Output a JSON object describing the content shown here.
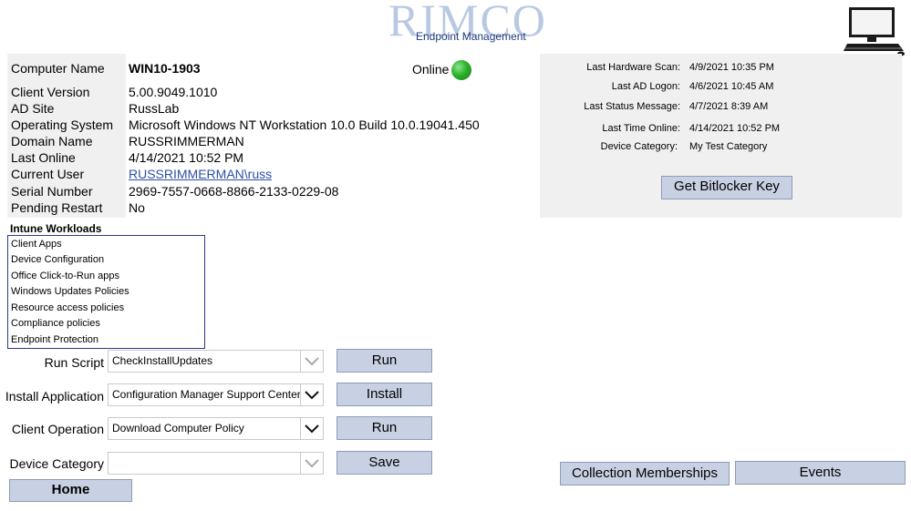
{
  "header": {
    "logo_word": "RIMCO",
    "logo_sub": "Endpoint Management"
  },
  "computer_info": {
    "rows": [
      {
        "label": "Computer Name",
        "value": "WIN10-1903"
      },
      {
        "label": "Client Version",
        "value": "5.00.9049.1010"
      },
      {
        "label": "AD Site",
        "value": "RussLab"
      },
      {
        "label": "Operating System",
        "value": "Microsoft Windows NT Workstation 10.0 Build 10.0.19041.450"
      },
      {
        "label": "Domain Name",
        "value": "RUSSRIMMERMAN"
      },
      {
        "label": "Last Online",
        "value": "4/14/2021 10:52 PM"
      },
      {
        "label": "Current User",
        "value": "RUSSRIMMERMAN\\russ"
      },
      {
        "label": "Serial Number",
        "value": "2969-7557-0668-8866-2133-0229-08"
      },
      {
        "label": "Pending Restart",
        "value": "No"
      }
    ],
    "status_text": "Online",
    "status_color": "#2bb32b"
  },
  "status_panel": {
    "rows": [
      {
        "label": "Last Hardware Scan:",
        "value": "4/9/2021 10:35 PM"
      },
      {
        "label": "Last AD Logon:",
        "value": "4/6/2021 10:45 AM"
      },
      {
        "label": "Last Status Message:",
        "value": "4/7/2021 8:39 AM"
      },
      {
        "label": "Last Time Online:",
        "value": "4/14/2021 10:52 PM"
      },
      {
        "label": "Device Category:",
        "value": "My Test Category"
      }
    ],
    "bitlocker_button": "Get Bitlocker Key"
  },
  "workloads": {
    "title": "Intune Workloads",
    "items": [
      "Client Apps",
      "Device Configuration",
      "Office Click-to-Run apps",
      "Windows Updates Policies",
      "Resource access policies",
      "Compliance policies",
      "Endpoint Protection"
    ]
  },
  "actions": {
    "run_script": {
      "label": "Run Script",
      "value": "CheckInstallUpdates",
      "button": "Run"
    },
    "install_app": {
      "label": "Install Application",
      "value": "Configuration Manager Support Center",
      "button": "Install"
    },
    "client_op": {
      "label": "Client Operation",
      "value": "Download Computer Policy",
      "button": "Run"
    },
    "device_cat": {
      "label": "Device Category",
      "value": "",
      "button": "Save"
    }
  },
  "footer": {
    "home": "Home",
    "collections": "Collection Memberships",
    "events": "Events"
  },
  "colors": {
    "panel_gray": "#f0f0f0",
    "button_fill": "#c8d1e3",
    "workload_border": "#2e3a8a",
    "link": "#2b4fa8"
  },
  "icons": [
    "computer-icon",
    "status-online-icon",
    "chevron-down-icon"
  ]
}
